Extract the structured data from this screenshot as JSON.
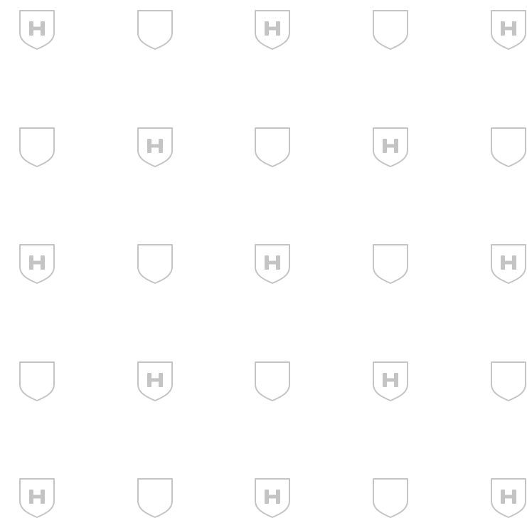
{
  "pattern": {
    "rows": 5,
    "cols": 5,
    "badge_letter": "H",
    "icon_color": "#c4c4c4",
    "background_color": "#ffffff",
    "cells": [
      [
        "lettered",
        "plain",
        "lettered",
        "plain",
        "lettered"
      ],
      [
        "plain",
        "lettered",
        "plain",
        "lettered",
        "plain"
      ],
      [
        "lettered",
        "plain",
        "lettered",
        "plain",
        "lettered"
      ],
      [
        "plain",
        "lettered",
        "plain",
        "lettered",
        "plain"
      ],
      [
        "lettered",
        "plain",
        "lettered",
        "plain",
        "lettered"
      ]
    ]
  }
}
